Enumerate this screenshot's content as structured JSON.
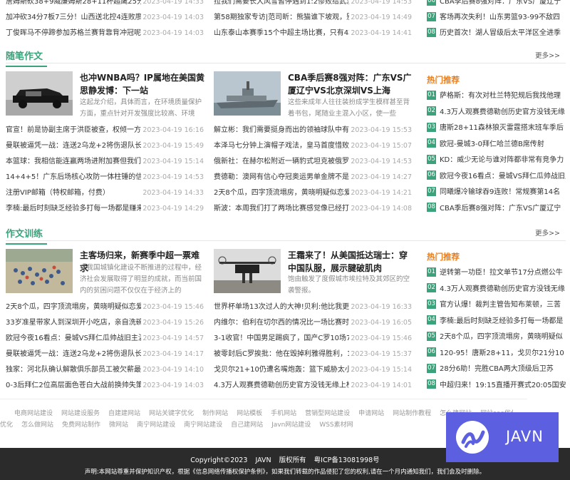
{
  "top_news": {
    "col1": [
      {
        "title": "詹姆斯砍38+9威廉姆斯28+11杯超鹰25分江",
        "date": "2023-04-19 14:33"
      },
      {
        "title": "加冲砍34分7板7三分！山西送北控4连败廖三",
        "date": "2023-04-19 14:03"
      },
      {
        "title": "丁俊晖马不停蹄参加苏格兰赛背靠背冲冠呢PK",
        "date": "2023-04-19 14:03"
      }
    ],
    "col2": [
      {
        "title": "拉我们需要长大风雪暂停遇到1:2惨败给武汉三",
        "date": "2023-04-19 14:53"
      },
      {
        "title": "第58期独家专访|范司昕：熊猫谁下坡观，别忘",
        "date": "2023-04-19 14:49"
      },
      {
        "title": "山东泰山本赛季15个中超主场比赛，只有4场",
        "date": "2023-04-19 14:41"
      }
    ],
    "hot": [
      {
        "num": "06",
        "title": "CBA季后赛8强对阵：广东VS广厦辽宁"
      },
      {
        "num": "07",
        "title": "客场再次失利！山东男篮93-99不敌四"
      },
      {
        "num": "08",
        "title": "历史首次！湖人冒级后太平洋区全进季"
      }
    ]
  },
  "section1": {
    "title": "随笔作文",
    "more": "更多>>",
    "features": [
      {
        "thumb": "old-car-photo-icon",
        "title": "也冲WNBA吗？IP属地在美国黄思静发博：下一站",
        "desc": "这起龙介绍，具体而言，在环境质量保护方面，重点针对开发强度比较高、环境"
      },
      {
        "thumb": "warship-photo-icon",
        "title": "CBA季后赛8强对阵：广东VS广厦辽宁VS北京深圳VS上海",
        "desc": "这些来成年人往往装扮成学生模样甚至背着书包，尾随业主混入小区，使一些"
      }
    ],
    "col1": [
      {
        "title": "官宣！前是协副主席于洪臣被查，权倾一方，",
        "date": "2023-04-19 16:16"
      },
      {
        "title": "曼联被逼凭一战：连送2乌龙+2将伤退队长灾",
        "date": "2023-04-19 15:49"
      },
      {
        "title": "本篮球：我相信能连赢两场进附加赛但我们得服",
        "date": "2023-04-19 15:14"
      },
      {
        "title": "14+4+5！广东后场核心攻防一体柱锤的信任",
        "date": "2023-04-19 14:53"
      },
      {
        "title": "注册VIP邮箱（特权邮箱，付费）",
        "date": "2023-04-19 14:33"
      },
      {
        "title": "李楠:最后时刻缺乏经验多打每一场都是赚来的",
        "date": "2023-04-19 14:29"
      }
    ],
    "col2": [
      {
        "title": "解立彬：我们需要挺身而出的领袖球队中有经",
        "date": "2023-04-19 15:53"
      },
      {
        "title": "本泽马七分钟上演帽子戏法，皇马首度惜败！",
        "date": "2023-04-19 15:07"
      },
      {
        "title": "俄新社：在赫尔松附近一辆豹式坦克被俄罗斯",
        "date": "2023-04-19 14:53"
      },
      {
        "title": "费德勒：澳网有信心夺冠奥运男单金牌不是必",
        "date": "2023-04-19 14:27"
      },
      {
        "title": "2天8个瓜，四字顶流塌房，黄晓明疑似恋爱，",
        "date": "2023-04-19 14:21"
      },
      {
        "title": "斯波：本周我们打了两场比赛感觉像已经打进",
        "date": "2023-04-19 14:08"
      }
    ],
    "hot_title": "热门推荐",
    "hot": [
      {
        "num": "01",
        "title": "萨格斯：有次对杜兰特犯规后我找他理"
      },
      {
        "num": "02",
        "title": "4.3万人观赛费德勒创历史官方没钱无缘"
      },
      {
        "num": "03",
        "title": "唐斯28+11森林狼灭雷霆搭末班车季后"
      },
      {
        "num": "04",
        "title": "欧冠-曼城3-0拜仁哈兰德B席传射"
      },
      {
        "num": "05",
        "title": "KD：威少无论与谁对阵都非常有竞争力"
      },
      {
        "num": "06",
        "title": "欧冠今夜16看点：曼城VS拜仁瓜帅战旧主"
      },
      {
        "num": "07",
        "title": "同曦爆冷输球吞9连败！常规赛第14名"
      },
      {
        "num": "08",
        "title": "CBA季后赛8强对阵：广东VS广厦辽宁"
      }
    ]
  },
  "section2": {
    "title": "作文训练",
    "more": "更多>>",
    "features": [
      {
        "thumb": "crowd-aerial-photo-icon",
        "title": "主客场归来，新赛季中超一票难求",
        "desc": "在我国城镇化建设不断推进的过程中，经济社会发展取得了明显的成就，而当前国内的贫困问题不仅仅在于经济上的"
      },
      {
        "thumb": "drone-photo-icon",
        "title": "王霜来了！从美国抵达瑞士：穿中国队服，展示腱破肌肉",
        "desc": "饱由触发了度假城市埃拉特及其郊区的空袭警报。"
      }
    ],
    "col1": [
      {
        "title": "2天8个瓜，四字顶流塌房，黄晓明疑似恋爱，",
        "date": "2023-04-19 15:46"
      },
      {
        "title": "33岁准星带家人到深圳开小吃店，亲自洗碗送",
        "date": "2023-04-19 15:26"
      },
      {
        "title": "欧冠今夜16看点：曼城VS拜仁瓜帅战旧主温米",
        "date": "2023-04-19 14:57"
      },
      {
        "title": "曼联被逼凭一战：连送2乌龙+2将伤退队长灾",
        "date": "2023-04-19 14:17"
      },
      {
        "title": "独家：河北队确认解散俱乐部员工被欠薪最长",
        "date": "2023-04-19 14:10"
      },
      {
        "title": "0-3后拜仁2位高层面色苍白大战前换帅失策",
        "date": "2023-04-19 14:03"
      }
    ],
    "col2": [
      {
        "title": "世界杯单场13次过人的大神!贝利:他比我更伟",
        "date": "2023-04-19 16:33"
      },
      {
        "title": "内维尔：伯利在切尔西的情况比一场比赛时更",
        "date": "2023-04-19 16:05"
      },
      {
        "title": "3-1收官！中国男足踢疯了，国产C罗10场7",
        "date": "2023-04-19 15:46"
      },
      {
        "title": "被零封后C罗挨批：他在毁掉利雅得胜利，10",
        "date": "2023-04-19 15:37"
      },
      {
        "title": "戈贝尔21+10仍遭名嘴炮轰：篮下威胁太小不",
        "date": "2023-04-19 15:14"
      },
      {
        "title": "4.3万人观赛费德勒创历史官方没钱无缘上榜吉",
        "date": "2023-04-19 14:01"
      }
    ],
    "hot_title": "热门推荐",
    "hot": [
      {
        "num": "01",
        "title": "逆转第一功臣！拉文单节17分点燃公牛"
      },
      {
        "num": "02",
        "title": "4.3万人观赛费德勒创历史官方没钱无缘"
      },
      {
        "num": "03",
        "title": "官方认爆！裁判主管告知布莱顿，三苦"
      },
      {
        "num": "04",
        "title": "李楠:最后时刻缺乏经验多打每一场都是"
      },
      {
        "num": "05",
        "title": "2天8个瓜，四字顶流塌房，黄晓明疑似"
      },
      {
        "num": "06",
        "title": "120-95！唐斯28+11，戈贝尔21分10"
      },
      {
        "num": "07",
        "title": "28分6助！完胜CBA两大顶级后卫苏"
      },
      {
        "num": "08",
        "title": "中超归来！19:15直播开赛式20:05国安"
      }
    ]
  },
  "links": {
    "row1": [
      "电商网站建设",
      "网站建设服务",
      "自建建网站",
      "网站关键字优化",
      "制作网站",
      "网站模板",
      "手机网站",
      "营销型网站建设",
      "申请网站",
      "网站制作教程",
      "怎么建网站",
      "网站seo优化"
    ],
    "row2": [
      "优化",
      "怎么做网站",
      "免费网站制作",
      "微网站",
      "南宁网站建设",
      "南宁网站建设",
      "自己建网站",
      "Javn网站建设",
      "WSS素材网"
    ]
  },
  "footer": {
    "copyright": "Copyright©2023",
    "brand": "JAVN",
    "rights": "版权所有",
    "icp": "粤ICP备13081998号",
    "notice": "声明:本网站尊重并保护知识产权，根据《信息网络传播权保护条例》，如果我们转载的作品侵犯了您的权利,请在一个月内通知我们，我们会及时删除。"
  },
  "badge": {
    "logo": "javn-logo-icon",
    "label": "JAVN",
    "color": "#5b5fe0"
  },
  "colors": {
    "accent": "#3aa37c",
    "hot_heading": "#e97d1b"
  }
}
